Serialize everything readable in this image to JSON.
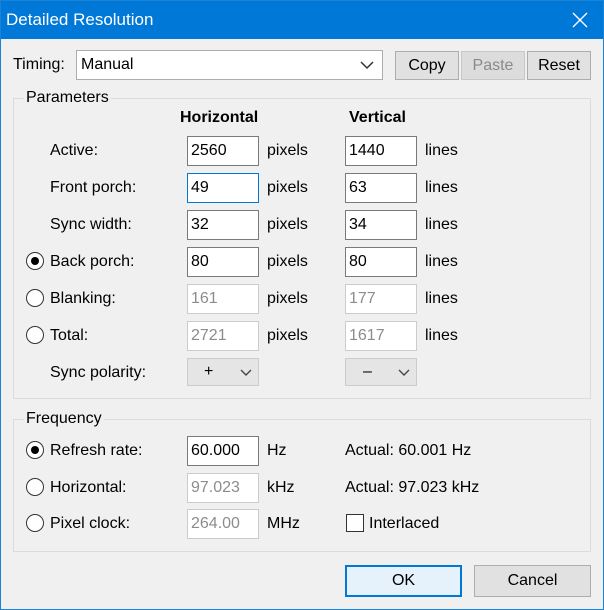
{
  "window": {
    "title": "Detailed Resolution"
  },
  "timing": {
    "label": "Timing:",
    "value": "Manual"
  },
  "toolbar": {
    "copy": "Copy",
    "paste": "Paste",
    "reset": "Reset"
  },
  "parameters": {
    "group_title": "Parameters",
    "horizontal_header": "Horizontal",
    "vertical_header": "Vertical",
    "unit_h": "pixels",
    "unit_v": "lines",
    "rows": [
      {
        "label": "Active:",
        "h": "2560",
        "v": "1440"
      },
      {
        "label": "Front porch:",
        "h": "49",
        "v": "63"
      },
      {
        "label": "Sync width:",
        "h": "32",
        "v": "34"
      },
      {
        "label": "Back porch:",
        "h": "80",
        "v": "80"
      },
      {
        "label": "Blanking:",
        "h": "161",
        "v": "177"
      },
      {
        "label": "Total:",
        "h": "2721",
        "v": "1617"
      }
    ],
    "sync_polarity": {
      "label": "Sync polarity:",
      "h": "+",
      "v": "–"
    }
  },
  "frequency": {
    "group_title": "Frequency",
    "refresh": {
      "label": "Refresh rate:",
      "value": "60.000",
      "unit": "Hz",
      "actual": "Actual: 60.001 Hz"
    },
    "horizontal": {
      "label": "Horizontal:",
      "value": "97.023",
      "unit": "kHz",
      "actual": "Actual: 97.023 kHz"
    },
    "pixel_clock": {
      "label": "Pixel clock:",
      "value": "264.00",
      "unit": "MHz"
    },
    "interlaced": "Interlaced"
  },
  "buttons": {
    "ok": "OK",
    "cancel": "Cancel"
  }
}
